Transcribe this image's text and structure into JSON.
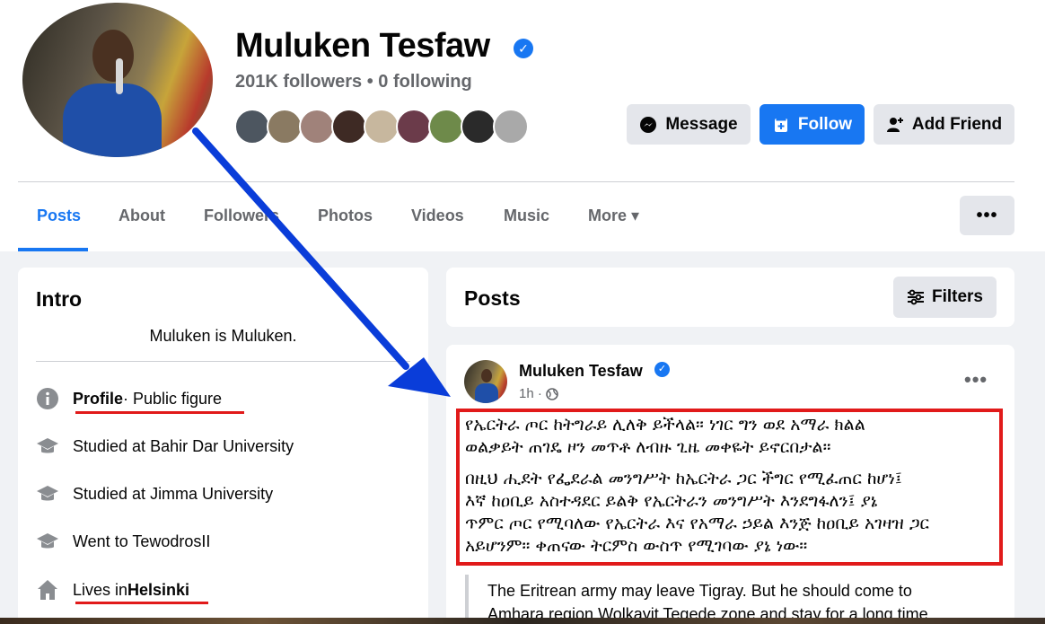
{
  "profile": {
    "name": "Muluken Tesfaw",
    "verified_mark": "✓",
    "follow_stats": "201K followers • 0 following"
  },
  "actions": {
    "message": "Message",
    "follow": "Follow",
    "add_friend": "Add Friend",
    "more": "•••"
  },
  "tabs": [
    "Posts",
    "About",
    "Followers",
    "Photos",
    "Videos",
    "Music",
    "More ▾"
  ],
  "intro": {
    "title": "Intro",
    "bio": "Muluken is Muluken.",
    "items": [
      {
        "icon": "info-icon",
        "bold": "Profile",
        "text": " · Public figure"
      },
      {
        "icon": "graduation-cap-icon",
        "text": "Studied at Bahir Dar University"
      },
      {
        "icon": "graduation-cap-icon",
        "text": "Studied at Jimma University"
      },
      {
        "icon": "graduation-cap-icon",
        "text": "Went to TewodrosII"
      },
      {
        "icon": "home-icon",
        "text": "Lives in ",
        "bold": "Helsinki"
      }
    ]
  },
  "posts": {
    "title": "Posts",
    "filters_label": "Filters"
  },
  "post": {
    "author": "Muluken Tesfaw",
    "time": "1h ·",
    "menu": "•••",
    "amharic_lines": [
      "የኤርትራ ጦር ከትግራይ ሊለቅ ይችላል። ነገር ግን ወደ አማራ ክልል",
      "ወልቃይት ጠገዴ ዞን መጥቶ ለብዙ ጊዜ መቀዬት ይኖርበታል።",
      "በዚህ ሒደት የፌደራል መንግሥት ከኤርትራ ጋር ችግር የሚፈጠር ከሆነ፤",
      "እኛ ከዐቢይ አስተዳደር ይልቅ የኤርትራን መንግሥት እንደግፋለን፤ ያኔ",
      "ጥምር ጦር የሚባለው የኤርትራ እና የአማራ ኃይል እንጅ ከዐቢይ አገዛዝ ጋር",
      "አይሆንም።  ቀጠናው ትርምስ ውስጥ የሚገባው ያኔ ነው።"
    ],
    "english_lines": [
      "The Eritrean army may leave Tigray. But he should come to",
      "Amhara region Wolkayit Tegede zone and stay for a long time."
    ]
  },
  "colors": {
    "facebook_blue": "#1877f2",
    "annotation_blue": "#0a3dd9",
    "annotation_red": "#e11a1a",
    "muted_text": "#65676b",
    "button_gray": "#e4e6eb"
  }
}
